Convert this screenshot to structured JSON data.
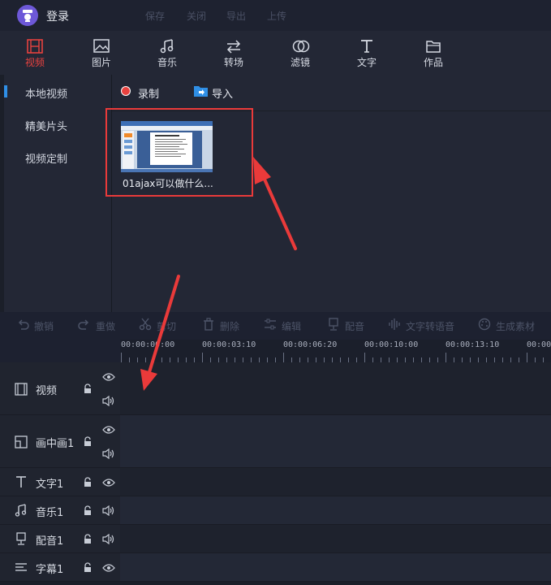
{
  "topbar": {
    "login_label": "登录",
    "menu": [
      "保存",
      "关闭",
      "导出",
      "上传"
    ]
  },
  "tabs": [
    {
      "label": "视频",
      "icon": "film-icon",
      "active": true
    },
    {
      "label": "图片",
      "icon": "image-icon",
      "active": false
    },
    {
      "label": "音乐",
      "icon": "music-icon",
      "active": false
    },
    {
      "label": "转场",
      "icon": "transition-icon",
      "active": false
    },
    {
      "label": "滤镜",
      "icon": "filter-icon",
      "active": false
    },
    {
      "label": "文字",
      "icon": "text-icon",
      "active": false
    },
    {
      "label": "作品",
      "icon": "folder-icon",
      "active": false
    }
  ],
  "sidebar": {
    "items": [
      {
        "label": "本地视频",
        "active": true
      },
      {
        "label": "精美片头",
        "active": false
      },
      {
        "label": "视频定制",
        "active": false
      }
    ]
  },
  "library": {
    "record_label": "录制",
    "import_label": "导入",
    "clip_name": "01ajax可以做什么..."
  },
  "edit_toolbar": [
    "撤销",
    "重做",
    "剪切",
    "删除",
    "编辑",
    "配音",
    "文字转语音",
    "生成素材"
  ],
  "ruler": {
    "labels": [
      "00:00:00:00",
      "00:00:03:10",
      "00:00:06:20",
      "00:00:10:00",
      "00:00:13:10",
      "00:00"
    ]
  },
  "tracks": [
    {
      "name": "视频",
      "icon": "film-icon"
    },
    {
      "name": "画中画1",
      "icon": "pip-icon"
    },
    {
      "name": "文字1",
      "icon": "text-icon"
    },
    {
      "name": "音乐1",
      "icon": "music-icon"
    },
    {
      "name": "配音1",
      "icon": "mic-icon"
    },
    {
      "name": "字幕1",
      "icon": "subtitle-icon"
    }
  ],
  "colors": {
    "accent_red": "#e8423f",
    "active_blue": "#2f8fe6",
    "annotation_red": "#ea3a3a"
  }
}
